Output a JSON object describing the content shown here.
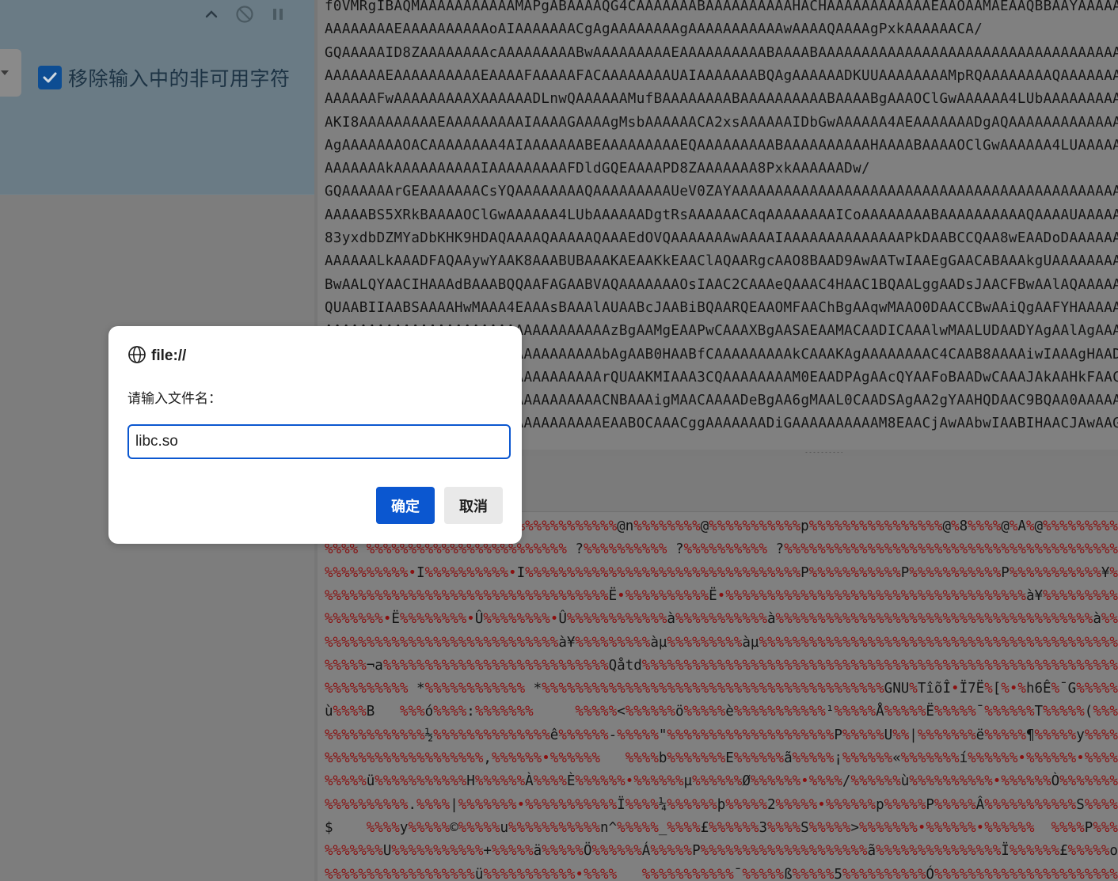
{
  "left_panel": {
    "checkbox_label": "移除输入中的非可用字符",
    "checkbox_checked": true,
    "toolbar_icons": [
      "chevron-up-icon",
      "ban-icon",
      "pause-icon"
    ]
  },
  "base64_lines": [
    "f0VMRgIBAQMAAAAAAAAAAAMAPgABAAAAQG4CAAAAAAABAAAAAAAAAAHACHAAAAAAAAAAAAEAAOAAMAEAAQBBAAYAAAAAAA",
    "AAAAAAAAEAAAAAAAAAAoAIAAAAAAACgAgAAAAAAAAgAAAAAAAAAAAwAAAAQAAAAgPxkAAAAAACA/",
    "GQAAAAAID8ZAAAAAAAAcAAAAAAAAABwAAAAAAAAAEAAAAAAAAAABAAAABAAAAAAAAAAAAAAAAAAAAAAAAAAAAAAAAAAAAAAAAAAAAAAAA",
    "AAAAAAAEAAAAAAAAAAEAAAAFAAAAAFACAAAAAAAAUAIAAAAAAABQAgAAAAAADKUUAAAAAAAAMpRQAAAAAAAAQAAAAAAAAAAAAAAAA",
    "AAAAAAFwAAAAAAAAAXAAAAAADLnwQAAAAAAMufBAAAAAAAABAAAAAAAAAABAAAABgAAAOClGwAAAAAA4LUbAAAAAAAAAAAAAAAA",
    "AKI8AAAAAAAAAEAAAAAAAAAIAAAAGAAAAgMsbAAAAAACA2xsAAAAAAIDbGwAAAAAA4AEAAAAAAADgAQAAAAAAAAAAAAAAAAA",
    "AgAAAAAAAOACAAAAAAAA4AIAAAAAAABEAAAAAAAAAEQAAAAAAAAABAAAAAAAAAAHAAAABAAAAOClGwAAAAAA4LUAAAAAAAAAA",
    "AAAAAAAkAAAAAAAAAAIAAAAAAAAAFDldGQEAAAAPD8ZAAAAAAA8PxkAAAAAADw/",
    "GQAAAAAArGEAAAAAAACsYQAAAAAAAAQAAAAAAAAAUeV0ZAYAAAAAAAAAAAAAAAAAAAAAAAAAAAAAAAAAAAAAAAAAAAAAAAAAAA",
    "AAAAABS5XRkBAAAAOClGwAAAAAA4LUbAAAAAADgtRsAAAAAACAqAAAAAAAAICoAAAAAAAABAAAAAAAAAAQAAAAUAAAAAAAAAAA",
    "83yxdbDZMYaDbKHK9HDAQAAAAQAAAAAQAAAEdOVQAAAAAAAwAAAAIAAAAAAAAAAAAAAPkDAABCCQAA8wEAADoDAAAAAAAAAA",
    "AAAAAALkAAADFAQAAywYAAK8AAABUBAAAKAEAAKkEAAClAQAARgcAAO8BAAD9AwAATwIAAEgGAACABAAAkgUAAAAAAAAAAAA",
    "BwAALQYAACIHAAAdBAAABQQAAFAGAABVAQAAAAAAAOsIAAC2CAAAeQAAAC4HAAC1BQAALggAADsJAACFBwAAlAQAAAAAAAAA",
    "QUAABIIAABSAAAAHwMAAA4EAAAsBAAAlAUAABcJAABiBQAARQEAAOMFAAChBgAAqwMAAO0DAACCBwAAiQgAAFYHAAAAAAAAAAA",
    "AAAAAAAAAAAAAAAAAAAAAAAAAAAAAAAAAzBgAAMgEAAPwCAAAXBgAASAEAAMACAADICAAAlwMAALUDAADYAgAAlAgAAAAAAAAA",
    "AAAAAAAAAAAAAAAAAAAAAAAAAAAAAAAAbAgAAB0HAABfCAAAAAAAAAkCAAAKAgAAAAAAAAC4CAAB8AAAAiwIAAAgHAADPCAAAvAAAAA",
    "AAAAAAAAAAAAAAAAAAAAAAAAAAAAAAAArQUAAKMIAAA3CQAAAAAAAAM0EAADPAgAAcQYAAFoBAADwCAAAJAkAAHkFAACpAwAAAAA",
    "AAAAAAAAAAAAAAAAAAAAAAAAAAAAAAAACNBAAAigMAACAAAADeBgAA6gMAAL0CAADSAgAA2gYAAHQDAAC9BQAA0AAAAAAAAABoAAA",
    "AAAAAAAAAAAAAAAAAAAAAAAAAAAAAAAAEAABOCAAACggAAAAAAADiGAAAAAAAAAAM8EAACjAwAAbwIAABIHAACJAwAAGwEAAJYHAAA"
  ],
  "output_lines": [
    "%%%%%%%%%%%%%%%%%%%%%%%%%%%%%%%%%%%@n%%%%%%%%@%%%%%%%%%%%p%%%%%%%%%%%%%%%%@%8%%%%@%A%@%%%%%%%%%%%%%%%%@%%%%%%%%%%%@",
    "%%%% %%%%%%%%%%%%%%%%%%%%%%%% ?%%%%%%%%%% ?%%%%%%%%%% ?%%%%%%%%%%%%%%%%%%%%%%%%%%%%%%%%%%%%%%%%%%%%%%%%%%%%%%%%%",
    "%%%%%%%%%%•I%%%%%%%%%%•I%%%%%%%%%%%%%%%%%%%%%%%%%%%%%%%%%P%%%%%%%%%%%P%%%%%%%%%%%P%%%%%%%%%%%¥%%%%%%%%%%¥%%%%%%%%%",
    "%%%%%%%%%%%%%%%%%%%%%%%%%%%%%%%%%%Ë•%%%%%%%%%%Ë•%%%%%%%%%%%%%%%%%%%%%%%%%%%%%%%%%%%%à¥%%%%%%%%%àµ%%%%%%%%àµ%%%%%%%%0P%%%",
    "%%%%%%%•Ë%%%%%%%%•Û%%%%%%%%•Û%%%%%%%%%%%%à%%%%%%%%%%%à%%%%%%%%%%%%%%%%%%%%%%%%%%%%%%%%%%%%%%à%%%%%%%%%%%à%%%%%%%%à%%%",
    "%%%%%%%%%%%%%%%%%%%%%%%%%%%%à¥%%%%%%%%%àµ%%%%%%%%%àµ%%%%%%%%%%%%%%%%%%%%%%%%%%%%%%%%%%%%%%%%%%%%%%%Påtd%%%%%%%<?%%%%%%%<",
    "%%%%%¬a%%%%%%%%%%%%%%%%%%%%%%%%%%%Qåtd%%%%%%%%%%%%%%%%%%%%%%%%%%%%%%%%%%%%%%%%%%%%%%%%%%%%%%%%%%%%%%%%%%%%%%%%Råtd%%%%",
    "%%%%%%%%%% *%%%%%%%%%%%% *%%%%%%%%%%%%%%%%%%%%%%%%%%%%%%%%%%%%%%%%%GNU%TîõÎ•Ï7Ë%[%•%h6Ê%¯G%%%%%%%%%%%%%%%%%%%%%%GNU%%",
    "ù%%%%B   %%%ó%%%%:%%%%%%%     %%%%%<%%%%%%ö%%%%%è%%%%%%%%%%%¹%%%%%Å%%%%%Ë%%%%%¯%%%%%%T%%%%%(%%%%©%%%%¥%%%%%F%%%%%ï%%%%ý",
    "%%%%%%%%%%%%½%%%%%%%%%%%%%%ê%%%%%%-%%%%%\"%%%%%%%%%%%%%%%%%%%%P%%%%%U%%|%%%%%%%ë%%%%%¶%%%%%y%%%%%.%%%%%µ%%%%%.%%%%%;   %%%•%%",
    "%%%%%%%%%%%%%%%%%%%,%%%%%%•%%%%%%   %%%%b%%%%%%%E%%%%%%ã%%%%%¡%%%%%%«%%%%%%%í%%%%%%•%%%%%%•%%%%V%%%%%&%%%%%f%%%%%K%%%%%s%%%%%%%%%%%%",
    "%%%%%ü%%%%%%%%%%%H%%%%%%À%%%%È%%%%%%•%%%%%%µ%%%%%%Ø%%%%%%•%%%%/%%%%%%ù%%%%%%%%%%•%%%%%%Ò%%%%%%%%^%%%%%%<%%%%¤%%%%%%%%%%%%_",
    "%%%%%%%%%%.%%%%|%%%%%%%•%%%%%%%%%%%Ï%%%%¼%%%%%%þ%%%%%2%%%%%•%%%%%%p%%%%%P%%%%%Â%%%%%%%%%%%S%%%%%•%%%%%£%%%%%7",
    "$    %%%%y%%%%%©%%%%%u%%%%%%%%%%%n^%%%%%_%%%%£%%%%%%3%%%%S%%%%%>%%%%%%%•%%%%%%•%%%%%%  %%%%P%%%%%ê%%%%%½%%%%%Ò%%%%%%Ú%%%%%%t%%",
    "%%%%%%%U%%%%%%%%%%%+%%%%%ä%%%%%Ö%%%%%%Á%%%%%P%%%%%%%%%%%%%%%%%%%%ã%%%%%%%%%%%%%%%Ï%%%%%%£%%%%%o%%%%%%%%%%%%•%%%%%%%%%%%%%%%%%%%%%b",
    "%%%%%%%%%%%%%%%%%%ü%%%%%%%%%%%•%%%%   %%%%%%%%%%%¯%%%%%ß%%%%%5%%%%%%%%%%Ó%%%%%%%%%%%%%%%%%%%%%%%%°%%%%%%â%%%>%%%%o%%%%%%X%%%%®%%"
  ],
  "dialog": {
    "origin": "file://",
    "message": "请输入文件名：",
    "input_value": "libc.so",
    "ok_label": "确定",
    "cancel_label": "取消"
  }
}
